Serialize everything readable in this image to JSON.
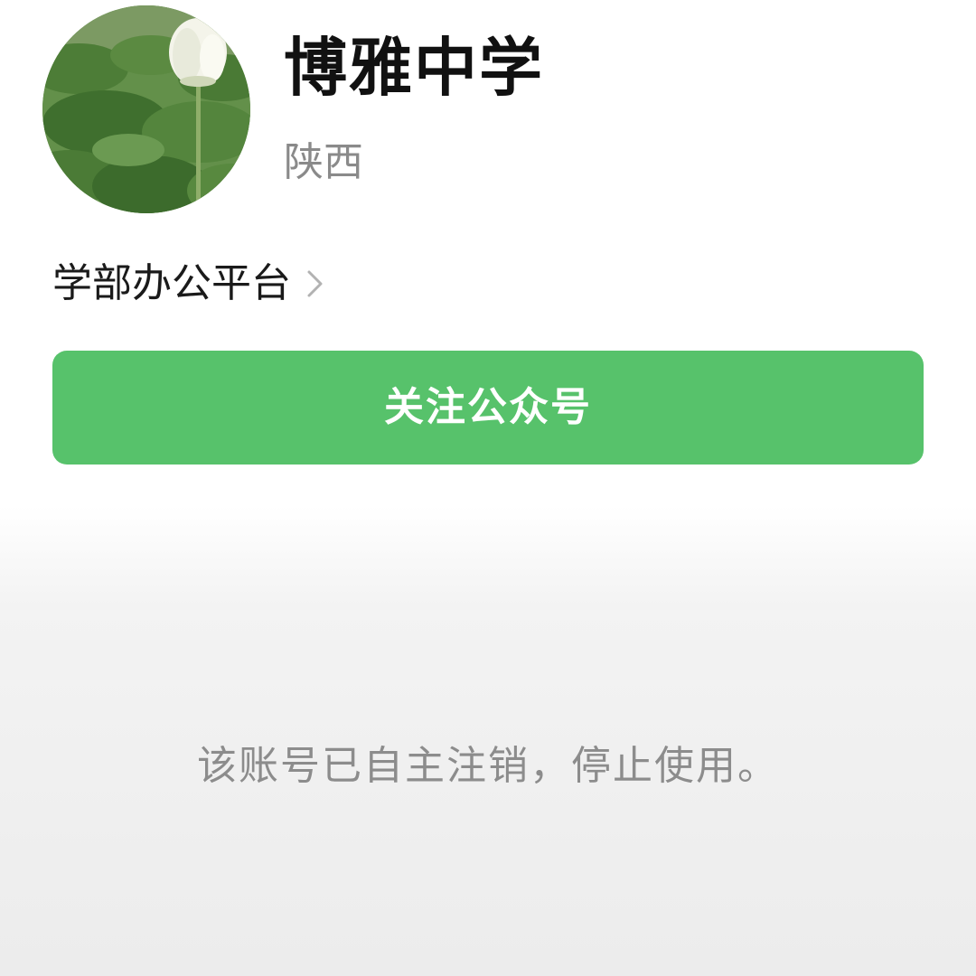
{
  "profile": {
    "account_name": "博雅中学",
    "region": "陕西",
    "owner": {
      "label": "学部办公平台",
      "chevron_icon": "chevron-right-icon"
    },
    "avatar_icon": "lotus-photo-avatar",
    "follow_button": {
      "label": "关注公众号",
      "color": "#57c26b"
    }
  },
  "notice": {
    "text": "该账号已自主注销，停止使用。"
  }
}
